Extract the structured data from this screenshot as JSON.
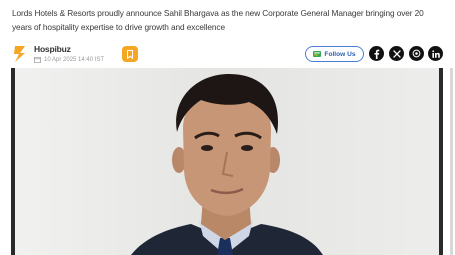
{
  "article": {
    "summary": "Lords Hotels & Resorts proudly announce Sahil Bhargava as the new Corporate General Manager bringing over 20 years of hospitality expertise to drive growth and excellence"
  },
  "source": {
    "name": "Hospibuz",
    "date": "10 Apr 2025 14:40 IST"
  },
  "actions": {
    "follow_label": "Follow Us",
    "bookmark_icon": "bookmark-icon"
  },
  "social": [
    "facebook-icon",
    "x-icon",
    "whatsapp-icon",
    "linkedin-icon"
  ],
  "colors": {
    "brand": "#f5a623",
    "follow_border": "#4a7fd6",
    "follow_text": "#2a5fb8",
    "social_bg": "#111111"
  }
}
